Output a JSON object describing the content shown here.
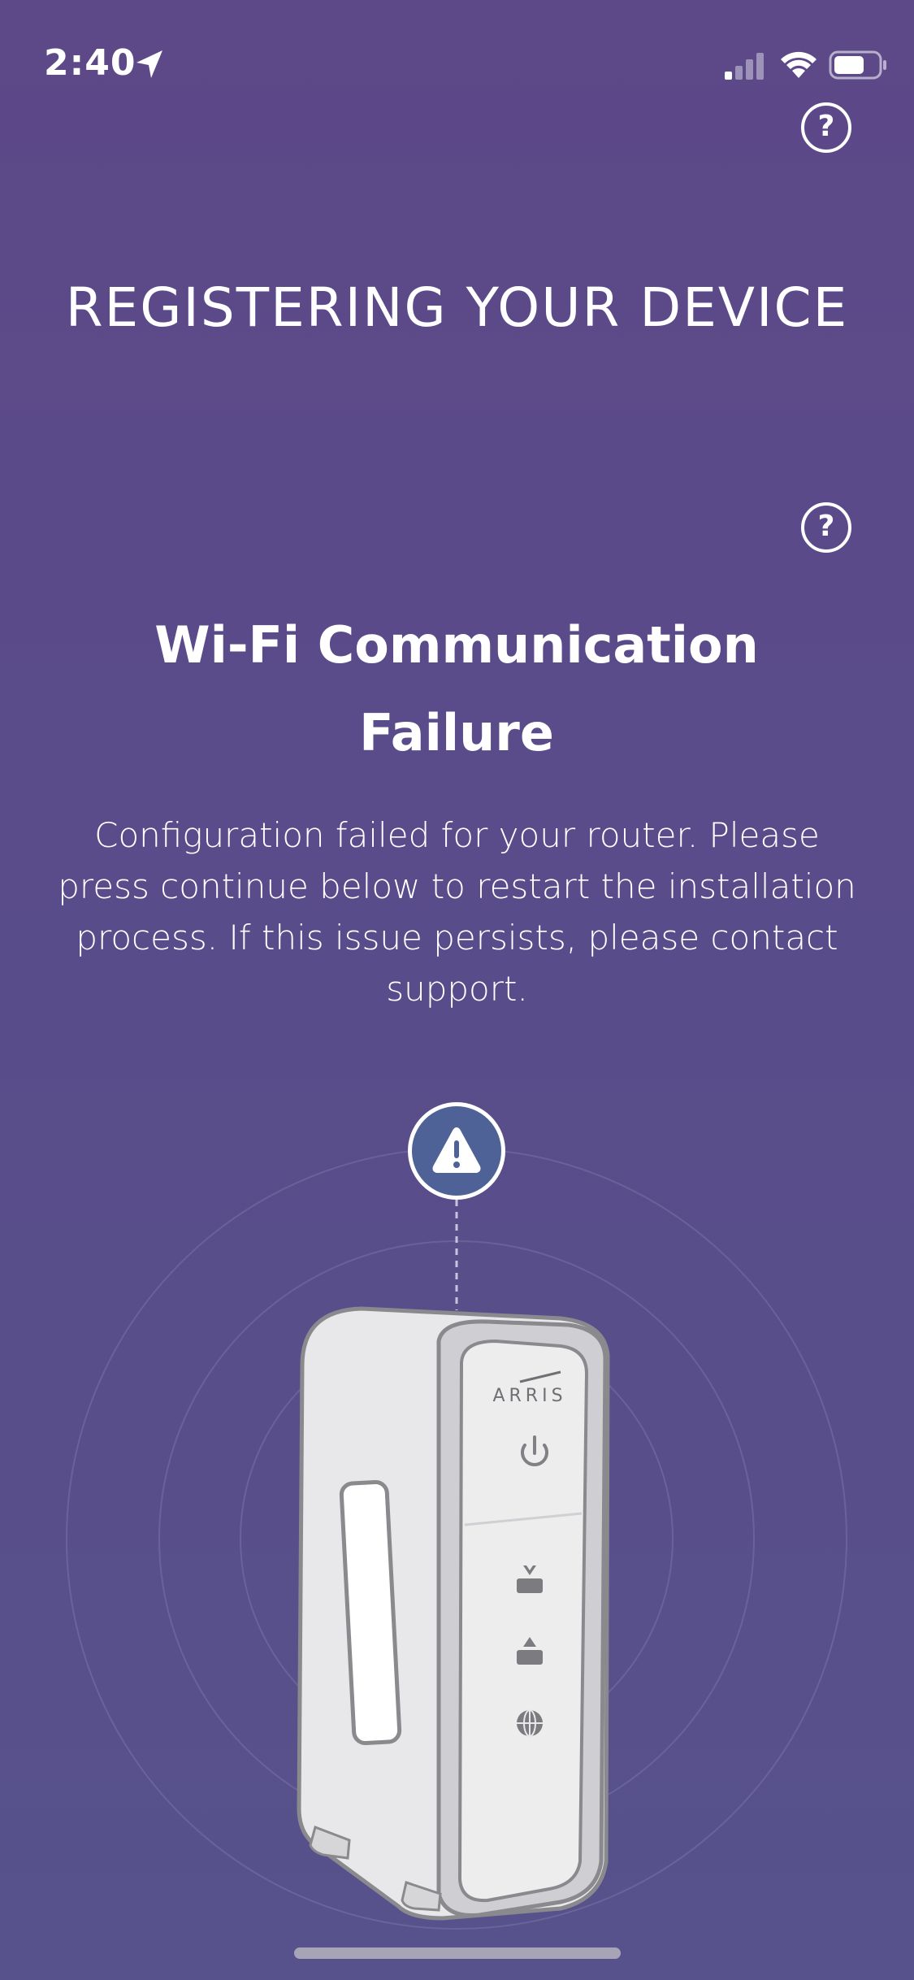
{
  "status_bar": {
    "time": "2:40"
  },
  "header": {
    "title": "REGISTERING YOUR DEVICE"
  },
  "error": {
    "title": "Wi-Fi Communication Failure",
    "message": "Configuration failed for your router. Please press continue below to restart the installation process. If this issue persists, please contact support."
  },
  "device": {
    "brand": "ARRIS"
  },
  "help_button": {
    "glyph": "?"
  },
  "icons": {
    "location": "location-arrow-icon",
    "signal": "cellular-signal-icon",
    "wifi": "wifi-icon",
    "battery": "battery-icon",
    "help": "question-circle-icon",
    "warning": "warning-triangle-icon",
    "power": "power-icon",
    "downstream": "downstream-icon",
    "upstream": "upstream-icon",
    "internet": "globe-icon"
  },
  "colors": {
    "background_top": "#5d4888",
    "background_bottom": "#57528b",
    "warning_badge": "#4e6297",
    "text": "#ffffff"
  }
}
